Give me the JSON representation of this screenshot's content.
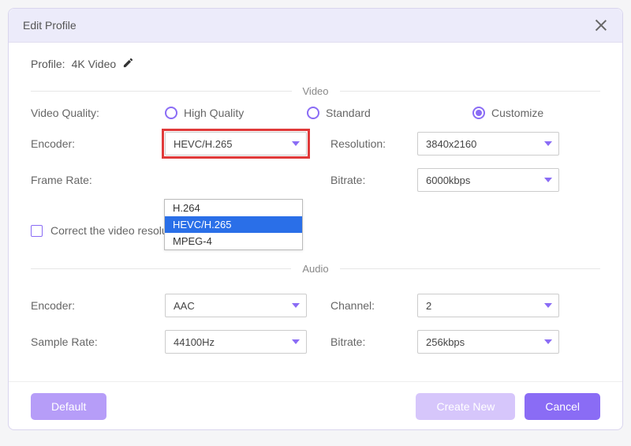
{
  "title": "Edit Profile",
  "profile": {
    "label": "Profile:",
    "value": "4K Video"
  },
  "sections": {
    "video": "Video",
    "audio": "Audio"
  },
  "video": {
    "qualityLabel": "Video Quality:",
    "qualityOptions": {
      "high": "High Quality",
      "standard": "Standard",
      "customize": "Customize"
    },
    "qualitySelected": "customize",
    "encoderLabel": "Encoder:",
    "encoderValue": "HEVC/H.265",
    "encoderOptions": [
      "H.264",
      "HEVC/H.265",
      "MPEG-4"
    ],
    "resolutionLabel": "Resolution:",
    "resolutionValue": "3840x2160",
    "frameRateLabel": "Frame Rate:",
    "bitrateLabel": "Bitrate:",
    "bitrateValue": "6000kbps",
    "correctLabel": "Correct the video resolution automatically."
  },
  "audio": {
    "encoderLabel": "Encoder:",
    "encoderValue": "AAC",
    "channelLabel": "Channel:",
    "channelValue": "2",
    "sampleRateLabel": "Sample Rate:",
    "sampleRateValue": "44100Hz",
    "bitrateLabel": "Bitrate:",
    "bitrateValue": "256kbps"
  },
  "buttons": {
    "default": "Default",
    "createNew": "Create New",
    "cancel": "Cancel"
  },
  "colors": {
    "accent": "#8a6cf5",
    "highlight": "#e03a3a"
  }
}
